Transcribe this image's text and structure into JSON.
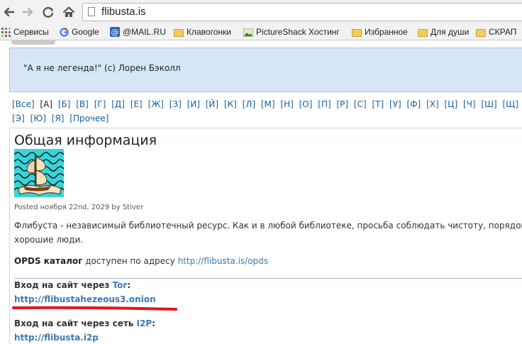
{
  "browser": {
    "url": "flibusta.is",
    "bookmarks": [
      {
        "label": "Сервисы",
        "icon": "apps-grid-icon"
      },
      {
        "label": "Google",
        "icon": "google-icon"
      },
      {
        "label": "@MAIL.RU",
        "icon": "mailru-icon"
      },
      {
        "label": "Клавогонки",
        "icon": "folder-icon"
      },
      {
        "label": "PictureShack Хостинг",
        "icon": "picture-icon"
      },
      {
        "label": "Избранное",
        "icon": "folder-icon"
      },
      {
        "label": "Для души",
        "icon": "folder-icon"
      },
      {
        "label": "СКРАП",
        "icon": "folder-icon"
      }
    ]
  },
  "page": {
    "quote": "\"А я не легенда!\" (c) Лорен Бэколл",
    "alphabet": [
      "[Все]",
      "[А]",
      "[Б]",
      "[В]",
      "[Г]",
      "[Д]",
      "[Е]",
      "[Ж]",
      "[З]",
      "[И]",
      "[Й]",
      "[К]",
      "[Л]",
      "[М]",
      "[Н]",
      "[О]",
      "[П]",
      "[Р]",
      "[С]",
      "[Т]",
      "[У]",
      "[Ф]",
      "[Х]",
      "[Ц]",
      "[Ч]",
      "[Ш]",
      "[Щ]",
      "[Э]",
      "[Ю]",
      "[Я]",
      "[Прочее]"
    ],
    "heading": "Общая информация",
    "posted": "Posted ноября 22nd, 2029 by Stiver",
    "description_line1": "Флибуста - независимый библиотечный ресурс. Как и в любой библиотеке, просьба соблюдать чистоту, порядок и с",
    "description_line2": "хорошие люди.",
    "opds_bold": "OPDS каталог",
    "opds_text": " доступен по адресу ",
    "opds_link": "http://flibusta.is/opds",
    "tor_label": "Вход на сайт через ",
    "tor_word": "Tor",
    "tor_colon": ":",
    "tor_url": "http://flibustahezeous3.onion",
    "i2p_label": "Вход на сайт через сеть ",
    "i2p_word": "I2P",
    "i2p_colon": ":",
    "i2p_url": "http://flibusta.i2p"
  },
  "colors": {
    "highlight_underline": "#e8141c",
    "link": "#3a7ab3"
  }
}
